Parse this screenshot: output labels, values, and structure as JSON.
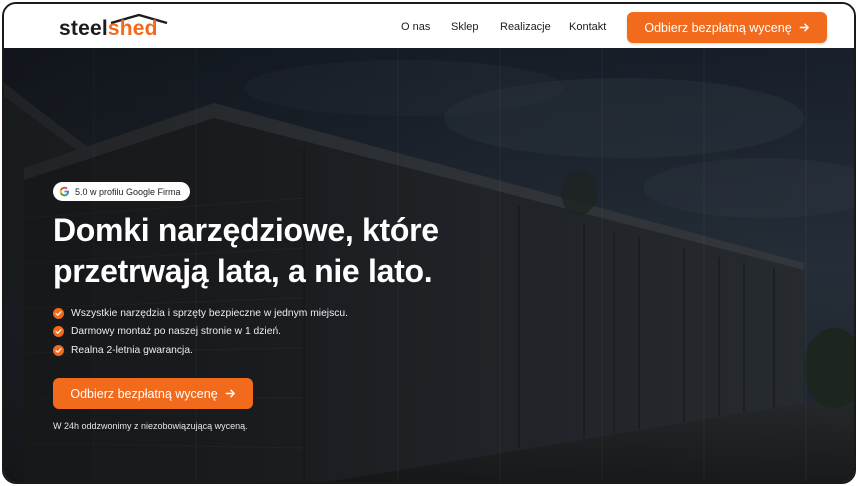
{
  "brand": {
    "logo_part1": "steel",
    "logo_part2": "shed",
    "accent_color": "#f26a1b"
  },
  "nav": {
    "items": [
      {
        "label": "O nas"
      },
      {
        "label": "Sklep"
      },
      {
        "label": "Realizacje"
      },
      {
        "label": "Kontakt"
      }
    ],
    "cta_label": "Odbierz bezpłatną wycenę",
    "cta_icon": "arrow-right-icon"
  },
  "hero": {
    "badge": {
      "icon": "google-icon",
      "text": "5.0 w profilu Google Firma"
    },
    "headline": [
      "Domki narzędziowe, które",
      "przetrwają lata, a nie lato."
    ],
    "features": [
      {
        "icon": "check-circle-icon",
        "text": "Wszystkie narzędzia i sprzęty bezpieczne w jednym miejscu."
      },
      {
        "icon": "check-circle-icon",
        "text": "Darmowy montaż po naszej stronie w 1 dzień."
      },
      {
        "icon": "check-circle-icon",
        "text": "Realna 2-letnia gwarancja."
      }
    ],
    "cta_label": "Odbierz bezpłatną wycenę",
    "cta_icon": "arrow-right-icon",
    "note": "W 24h oddzwonimy z niezobowiązującą wyceną."
  }
}
